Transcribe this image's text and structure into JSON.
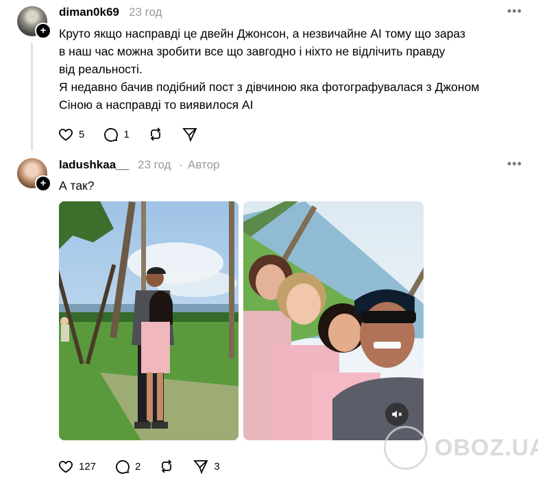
{
  "comment1": {
    "username": "diman0k69",
    "time": "23 год",
    "more": "•••",
    "lines": [
      "Круто якщо насправді це двейн Джонсон, а незвичайне AI тому що зараз",
      "в наш час можна зробити все що завгодно і ніхто не відлічить правду",
      "від реальності.",
      "Я недавно бачив подібний пост з дівчиною яка фотографувалася з Джоном",
      "Сіною а насправді то виявилося AI"
    ],
    "likes": "5",
    "replies": "1"
  },
  "comment2": {
    "username": "ladushkaa__",
    "time": "23 год",
    "separator": "·",
    "author_label": "Автор",
    "more": "•••",
    "text": "А так?",
    "likes": "127",
    "replies": "2",
    "shares": "3"
  },
  "watermark": {
    "text": "OBOZ.UA"
  },
  "icons": [
    "heart-icon",
    "comment-icon",
    "repost-icon",
    "share-icon",
    "mute-icon",
    "plus-icon",
    "more-icon"
  ]
}
